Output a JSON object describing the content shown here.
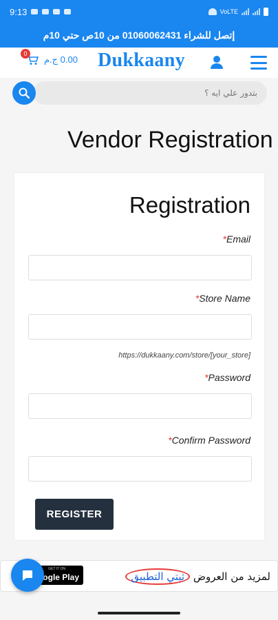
{
  "status_bar": {
    "time": "9:13",
    "network_label": "VoLTE"
  },
  "promo": {
    "text": "إتصل للشراء 01060062431 من 10ص حتي 10م"
  },
  "header": {
    "cart_amount": "0.00 ج.م",
    "cart_count": "0",
    "logo": "Dukkaany"
  },
  "search": {
    "placeholder": "بتدور علي ايه ؟"
  },
  "page": {
    "title": "Vendor Registration"
  },
  "form": {
    "title": "Registration",
    "email_label": "Email",
    "store_name_label": "Store Name",
    "store_url_hint": "https://dukkaany.com/store/[your_store]",
    "password_label": "Password",
    "confirm_password_label": "Confirm Password",
    "required_mark": "*",
    "register_label": "REGISTER"
  },
  "banner": {
    "get_it_on": "GET IT ON",
    "google_play": "Google Play",
    "prefix_text": "لمزيد من العروض",
    "app_link_text": "ثبتي التطبيق"
  },
  "colors": {
    "primary": "#1a86ef",
    "button_dark": "#25303f",
    "required": "#e53935"
  }
}
